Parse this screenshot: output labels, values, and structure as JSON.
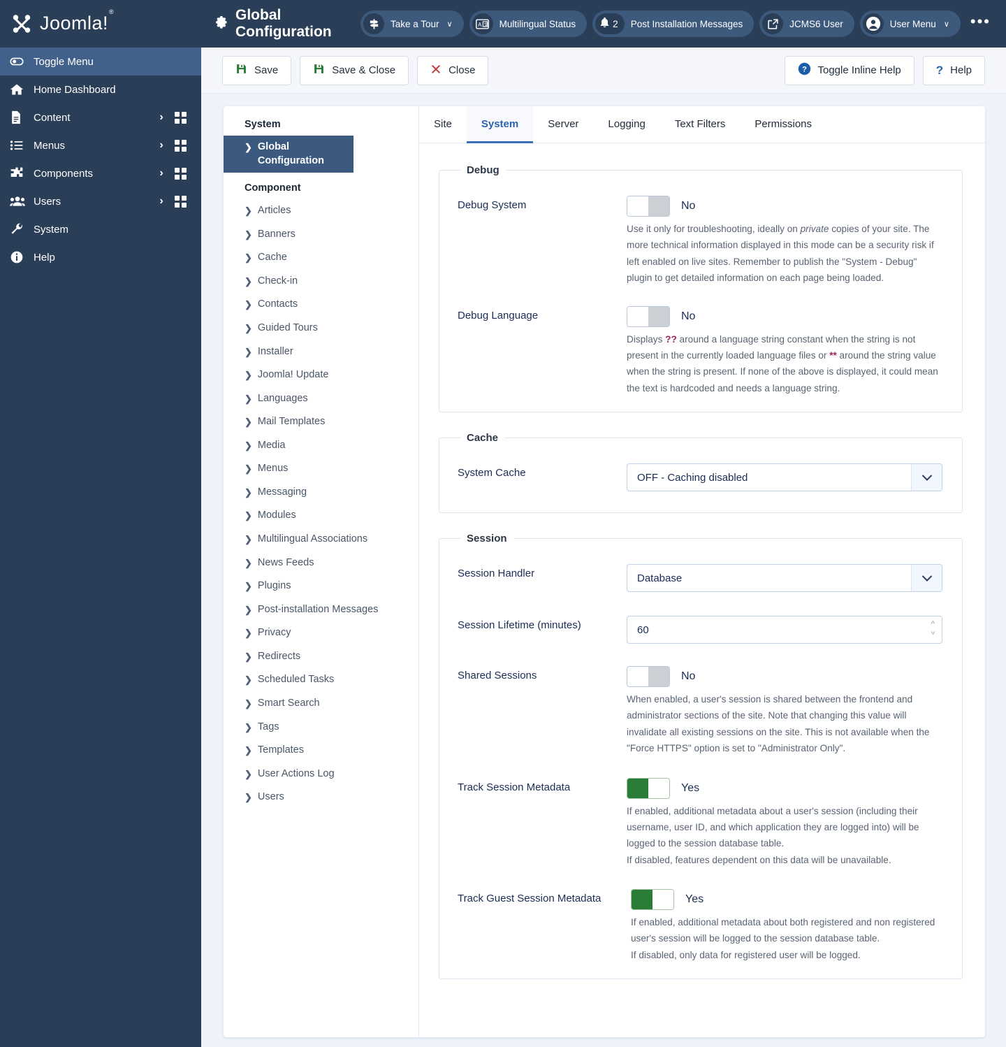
{
  "brand": {
    "name": "Joomla!",
    "trademark": "®"
  },
  "sidebar": {
    "items": [
      {
        "label": "Toggle Menu",
        "icon": "toggle-icon",
        "active": true
      },
      {
        "label": "Home Dashboard",
        "icon": "home-icon"
      },
      {
        "label": "Content",
        "icon": "document-icon",
        "chevron": "›",
        "grid": true
      },
      {
        "label": "Menus",
        "icon": "list-icon",
        "chevron": "›",
        "grid": true
      },
      {
        "label": "Components",
        "icon": "puzzle-icon",
        "chevron": "›",
        "grid": true
      },
      {
        "label": "Users",
        "icon": "users-icon",
        "chevron": "›",
        "grid": true
      },
      {
        "label": "System",
        "icon": "wrench-icon"
      },
      {
        "label": "Help",
        "icon": "info-icon"
      }
    ]
  },
  "header": {
    "title": "Global Configuration",
    "title_icon": "gear-icon",
    "pills": [
      {
        "label": "Take a Tour",
        "icon": "signpost-icon",
        "chevron": "∨"
      },
      {
        "label": "Multilingual Status",
        "icon": "language-icon"
      },
      {
        "label": "Post Installation Messages",
        "icon": "bell-icon",
        "count": "2"
      },
      {
        "label": "JCMS6 User",
        "icon": "external-link-icon"
      },
      {
        "label": "User Menu",
        "icon": "user-circle-icon",
        "chevron": "∨"
      }
    ],
    "more_icon": "ellipsis-icon"
  },
  "toolbar": {
    "save": "Save",
    "save_close": "Save & Close",
    "close": "Close",
    "toggle_inline_help": "Toggle Inline Help",
    "help": "Help"
  },
  "side_panel": {
    "system_heading": "System",
    "system_items": [
      {
        "label": "Global Configuration",
        "selected": true
      }
    ],
    "component_heading": "Component",
    "component_items": [
      {
        "label": "Articles"
      },
      {
        "label": "Banners"
      },
      {
        "label": "Cache"
      },
      {
        "label": "Check-in"
      },
      {
        "label": "Contacts"
      },
      {
        "label": "Guided Tours"
      },
      {
        "label": "Installer"
      },
      {
        "label": "Joomla! Update"
      },
      {
        "label": "Languages"
      },
      {
        "label": "Mail Templates"
      },
      {
        "label": "Media"
      },
      {
        "label": "Menus"
      },
      {
        "label": "Messaging"
      },
      {
        "label": "Modules"
      },
      {
        "label": "Multilingual Associations"
      },
      {
        "label": "News Feeds"
      },
      {
        "label": "Plugins"
      },
      {
        "label": "Post-installation Messages"
      },
      {
        "label": "Privacy"
      },
      {
        "label": "Redirects"
      },
      {
        "label": "Scheduled Tasks"
      },
      {
        "label": "Smart Search"
      },
      {
        "label": "Tags"
      },
      {
        "label": "Templates"
      },
      {
        "label": "User Actions Log"
      },
      {
        "label": "Users"
      }
    ]
  },
  "tabs": [
    {
      "label": "Site",
      "active": false
    },
    {
      "label": "System",
      "active": true
    },
    {
      "label": "Server",
      "active": false
    },
    {
      "label": "Logging",
      "active": false
    },
    {
      "label": "Text Filters",
      "active": false
    },
    {
      "label": "Permissions",
      "active": false
    }
  ],
  "groups": {
    "debug": {
      "legend": "Debug",
      "debug_system": {
        "label": "Debug System",
        "value": "No",
        "state": "off",
        "desc_1": "Use it only for troubleshooting, ideally on ",
        "desc_em": "private",
        "desc_2": " copies of your site. The more technical information displayed in this mode can be a security risk if left enabled on live sites. Remember to publish the \"System - Debug\" plugin to get detailed information on each page being loaded."
      },
      "debug_language": {
        "label": "Debug Language",
        "value": "No",
        "state": "off",
        "desc_1": "Displays ",
        "hl_1": "??",
        "desc_2": " around a language string constant when the string is not present in the currently loaded language files or ",
        "hl_2": "**",
        "desc_3": " around the string value when the string is present. If none of the above is displayed, it could mean the text is hardcoded and needs a language string."
      }
    },
    "cache": {
      "legend": "Cache",
      "system_cache": {
        "label": "System Cache",
        "value": "OFF - Caching disabled"
      }
    },
    "session": {
      "legend": "Session",
      "session_handler": {
        "label": "Session Handler",
        "value": "Database"
      },
      "session_lifetime": {
        "label": "Session Lifetime (minutes)",
        "value": "60"
      },
      "shared_sessions": {
        "label": "Shared Sessions",
        "value": "No",
        "state": "off",
        "desc": "When enabled, a user's session is shared between the frontend and administrator sections of the site. Note that changing this value will invalidate all existing sessions on the site. This is not available when the \"Force HTTPS\" option is set to \"Administrator Only\"."
      },
      "track_session_metadata": {
        "label": "Track Session Metadata",
        "value": "Yes",
        "state": "on",
        "desc_line1": "If enabled, additional metadata about a user's session (including their username, user ID, and which application they are logged into) will be logged to the session database table.",
        "desc_line2": "If disabled, features dependent on this data will be unavailable."
      },
      "track_guest_session_metadata": {
        "label": "Track Guest Session Metadata",
        "value": "Yes",
        "state": "on",
        "desc_line1": "If enabled, additional metadata about both registered and non registered user's session will be logged to the session database table.",
        "desc_line2": "If disabled, only data for registered user will be logged."
      }
    }
  },
  "colors": {
    "sidebar_bg": "#2a3e57",
    "accent": "#2a63b0",
    "toggle_on": "#2a7d36",
    "highlight": "#9c2458",
    "selected_item": "#3c5a80"
  }
}
